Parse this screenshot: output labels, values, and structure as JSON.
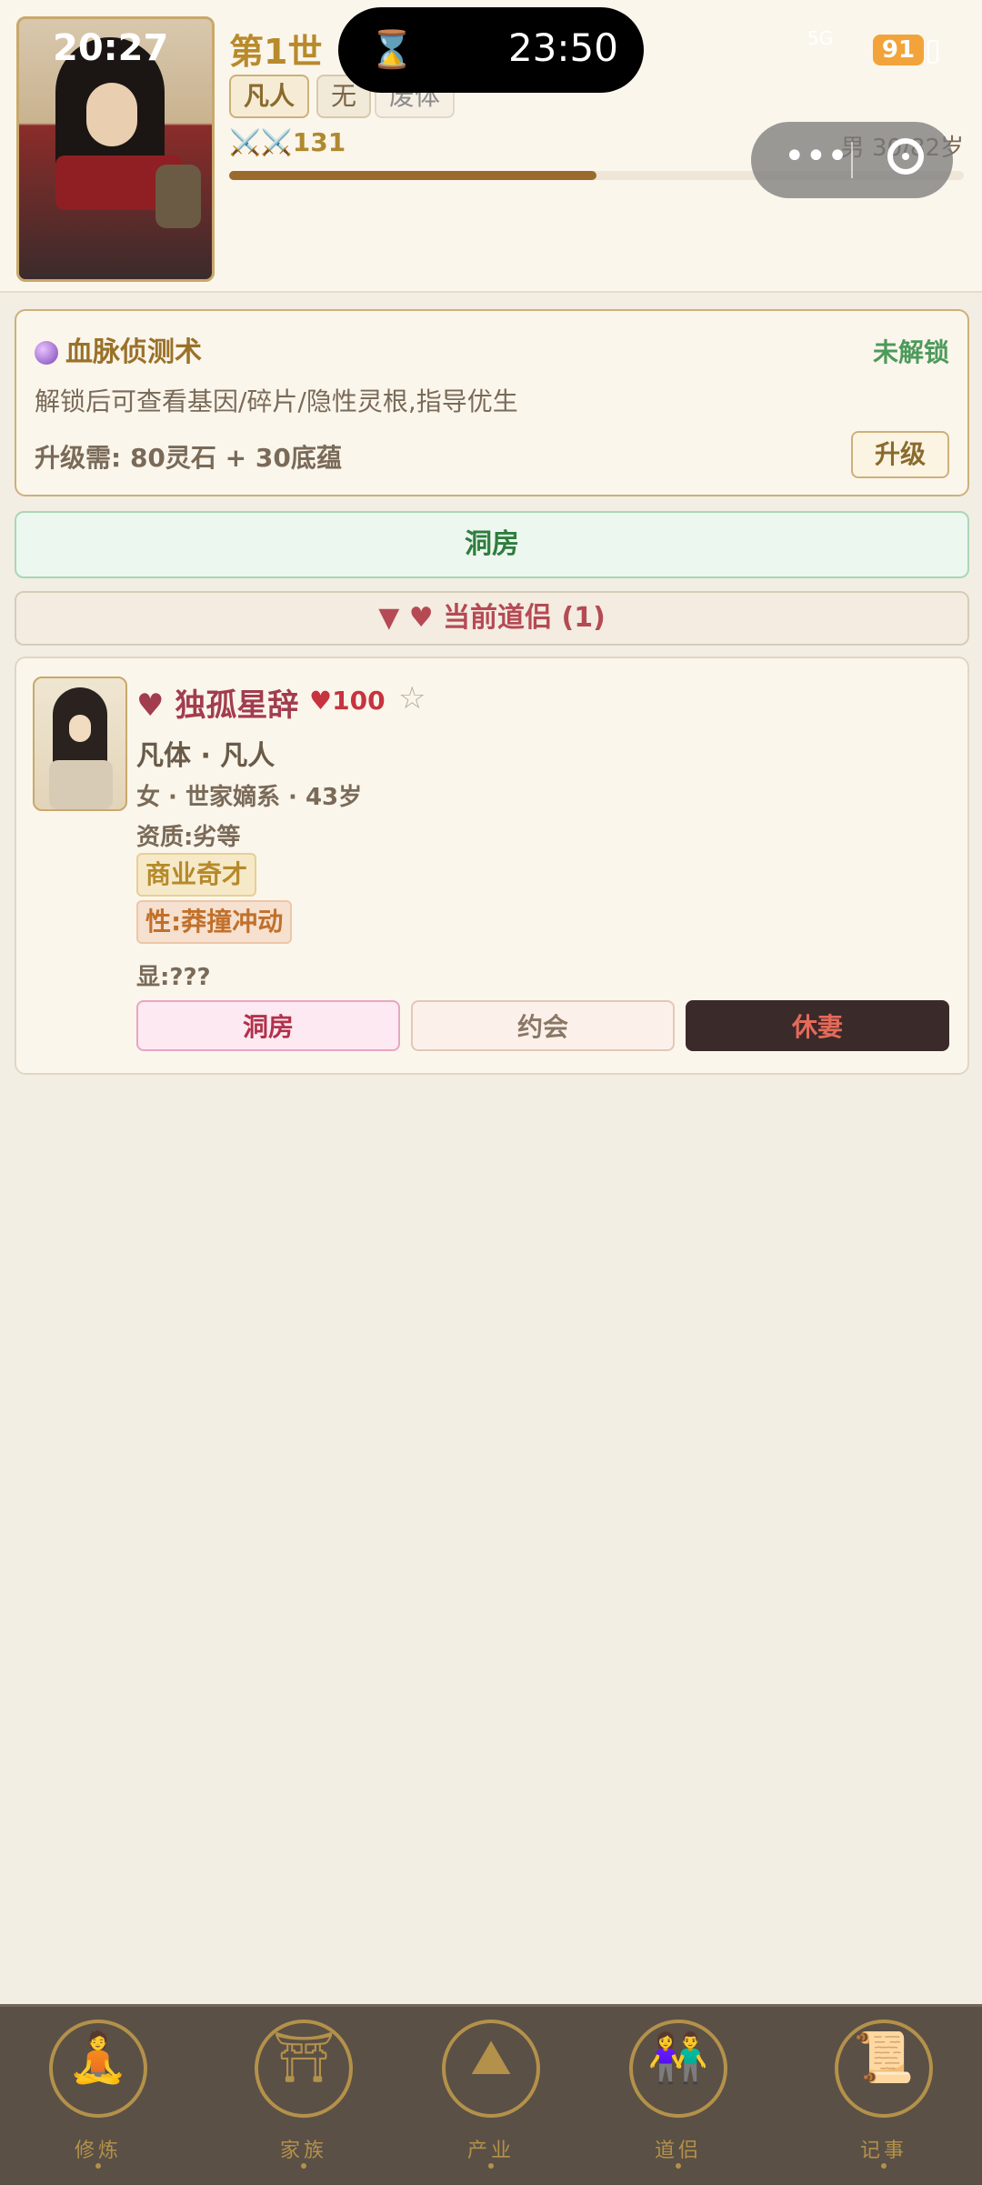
{
  "status_bar": {
    "time": "20:27",
    "timer": "23:50",
    "network": "5G",
    "battery": "91"
  },
  "header": {
    "title": "第1世",
    "badges": [
      "凡人",
      "无",
      "废体"
    ],
    "power": "⚔️⚔️131",
    "gender_age": "男 30/82岁",
    "lifespan_progress": 0.5
  },
  "bloodline_panel": {
    "title": "血脉侦测术",
    "status": "未解锁",
    "description": "解锁后可查看基因/碎片/隐性灵根,指导优生",
    "cost": "升级需: 80灵石 + 30底蕴",
    "upgrade_button": "升级"
  },
  "main_action": "洞房",
  "partner_section": {
    "toggle_label": "▼ ♥ 当前道侣 (1)",
    "partner": {
      "name_heart": "♥",
      "name": "独孤星辞",
      "affection": "♥100",
      "star": "☆",
      "constitution": "凡体 · 凡人",
      "info": "女 · 世家嫡系 · 43岁",
      "aptitude": "资质:劣等",
      "traits": [
        "商业奇才",
        "性:莽撞冲动"
      ],
      "hidden": "显:???",
      "buttons": [
        "洞房",
        "约会",
        "休妻"
      ]
    }
  },
  "bottom_nav": {
    "items": [
      {
        "label": "修炼",
        "icon": "meditation-icon"
      },
      {
        "label": "家族",
        "icon": "pagoda-icon"
      },
      {
        "label": "产业",
        "icon": "mountain-icon"
      },
      {
        "label": "道侣",
        "icon": "couple-icon"
      },
      {
        "label": "记事",
        "icon": "scroll-icon"
      }
    ]
  }
}
